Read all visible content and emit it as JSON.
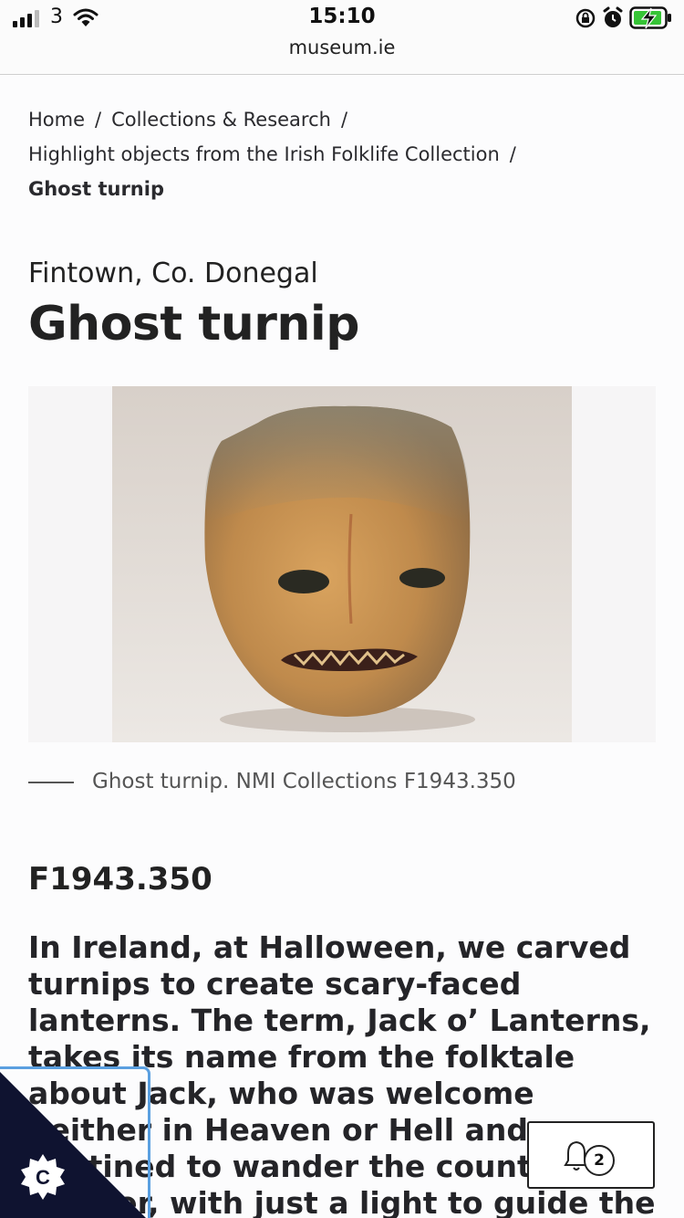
{
  "status_bar": {
    "carrier": "3",
    "time": "15:10",
    "url": "museum.ie"
  },
  "breadcrumb": {
    "items": [
      "Home",
      "Collections & Research",
      "Highlight objects from the Irish Folklife Collection"
    ],
    "separator": "/",
    "current": "Ghost turnip"
  },
  "object": {
    "location": "Fintown, Co. Donegal",
    "title": "Ghost turnip",
    "caption": "Ghost turnip. NMI Collections F1943.350",
    "reference": "F1943.350",
    "description": "In Ireland, at Halloween, we carved turnips to create scary-faced lanterns. The term, Jack o’ Lanterns, takes its name from the folktale about Jack, who was welcome neither in Heaven or Hell and was destined to wander the countryside forever, with just a light to guide the way."
  },
  "consent_widget": {
    "letter": "C"
  },
  "notifications": {
    "count": "2"
  },
  "colors": {
    "text": "#222222",
    "consent_dark": "#0f1330",
    "consent_outline": "#5a9fe0"
  }
}
